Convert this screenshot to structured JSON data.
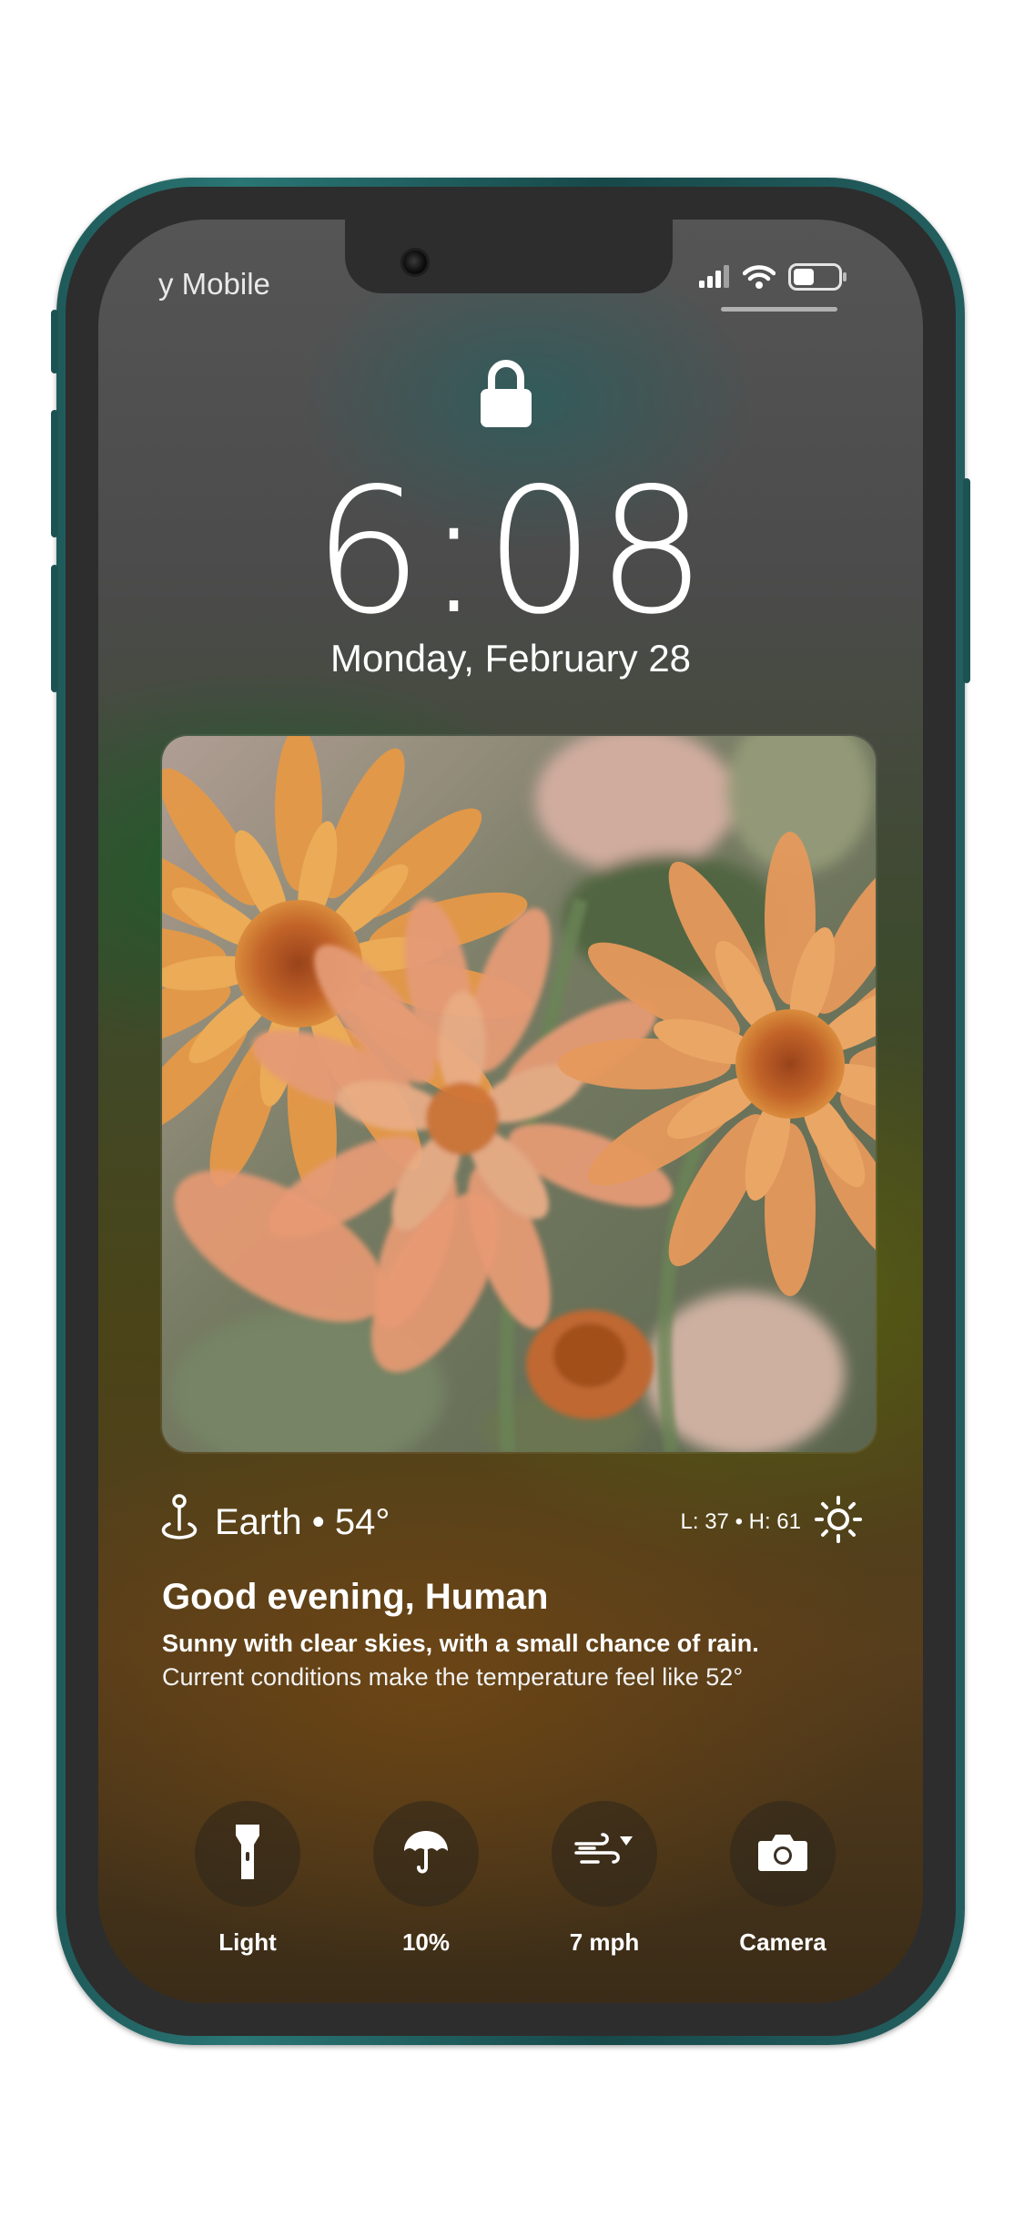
{
  "status_bar": {
    "carrier": "y Mobile",
    "icons": [
      "cellular-signal-icon",
      "wifi-icon",
      "battery-icon"
    ]
  },
  "lock_screen": {
    "lock_icon": "lock-icon",
    "time": "6:08",
    "date": "Monday, February 28"
  },
  "photo_widget": {
    "subject": "flower-photo"
  },
  "weather": {
    "location_icon": "location-pin-icon",
    "location_and_temp": "Earth • 54°",
    "low_high": "L: 37 • H: 61",
    "condition_icon": "sun-icon",
    "greeting": "Good evening, Human",
    "summary": "Sunny with clear skies, with a small chance of rain.",
    "detail": "Current conditions make the temperature feel like 52°"
  },
  "actions": [
    {
      "icon": "flashlight-icon",
      "label": "Light"
    },
    {
      "icon": "umbrella-icon",
      "label": "10%"
    },
    {
      "icon": "wind-icon",
      "label": "7 mph"
    },
    {
      "icon": "camera-icon",
      "label": "Camera"
    }
  ],
  "colors": {
    "frame": "#1f5a5a",
    "bezel": "#2d2d2d",
    "text": "#ffffff"
  }
}
